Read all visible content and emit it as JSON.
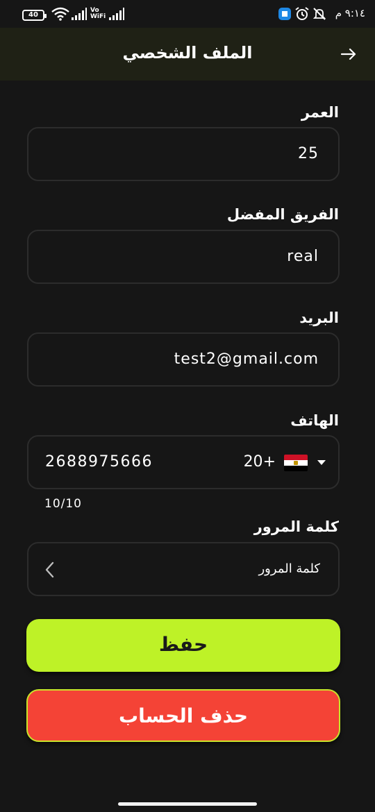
{
  "status_bar": {
    "time": "٩:١٤ م",
    "battery": "40",
    "network_label": "Vo\nWiFi"
  },
  "header": {
    "title": "الملف الشخصي",
    "back_icon": "arrow-right-icon"
  },
  "form": {
    "age": {
      "label": "العمر",
      "value": "25"
    },
    "favorite_team": {
      "label": "الفريق المفضل",
      "value": "real"
    },
    "email": {
      "label": "البريد",
      "value": "test2@gmail.com"
    },
    "phone": {
      "label": "الهاتف",
      "country_code": "+20",
      "country_flag": "egypt-flag-icon",
      "number": "2688975666",
      "counter": "10/10"
    },
    "password": {
      "label": "كلمة المرور",
      "value": "كلمة المرور"
    }
  },
  "buttons": {
    "save_label": "حفظ",
    "delete_label": "حذف الحساب"
  },
  "colors": {
    "accent": "#bef227",
    "danger": "#f44336",
    "background": "#161616",
    "header": "#1f2115"
  }
}
